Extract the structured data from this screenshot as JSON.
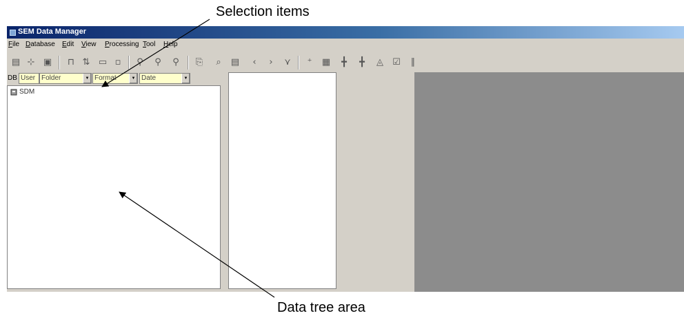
{
  "annotations": {
    "selection_items": "Selection items",
    "data_tree_area": "Data tree area"
  },
  "window": {
    "title": "SEM Data Manager",
    "menu": [
      "File",
      "Database",
      "Edit",
      "View",
      "Processing",
      "Tool",
      "Help"
    ]
  },
  "toolbar": {
    "icons": [
      "save-icon",
      "connect-icon",
      "database-icon",
      "filter-icon",
      "move-icon",
      "copy-icon",
      "paste-icon",
      "pin-icon",
      "pin-add-icon",
      "pin-remove-icon",
      "page-icon",
      "zoom-icon",
      "view-icon",
      "back-icon",
      "forward-icon",
      "select-icon",
      "tag-icon",
      "grid-icon",
      "layout-a-icon",
      "layout-b-icon",
      "layout-c-icon",
      "check-icon",
      "columns-icon"
    ]
  },
  "selection": {
    "db_label": "DB",
    "user_label": "User",
    "folder_label": "Folder",
    "format_label": "Format",
    "date_label": "Date"
  },
  "tree": {
    "root": "SDM"
  },
  "colors": {
    "titlebar_start": "#0a246a",
    "titlebar_end": "#a6caf0",
    "selection_field": "#ffffcc",
    "preview_area": "#8c8c8c"
  }
}
